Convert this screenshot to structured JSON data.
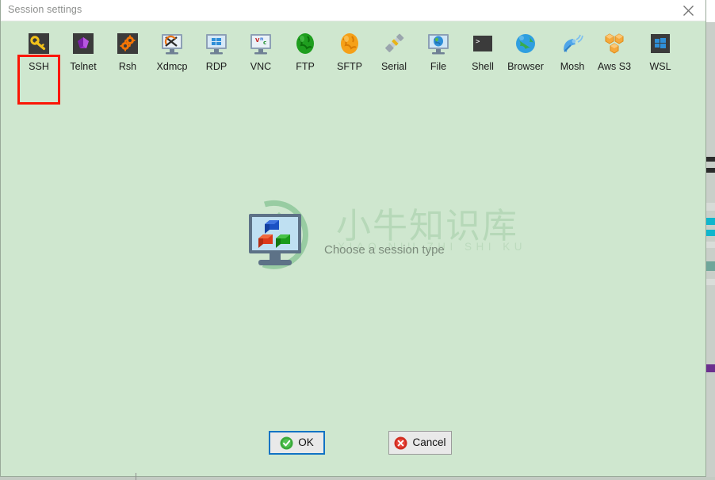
{
  "window": {
    "title": "Session settings",
    "close_icon": "close-icon",
    "background_color": "#cfe7cf",
    "titlebar_color": "#ffffff"
  },
  "session_types": {
    "selected": "SSH",
    "selection_color": "#fb1605",
    "items": [
      {
        "label": "SSH",
        "icon": "key-icon"
      },
      {
        "label": "Telnet",
        "icon": "telnet-crystal-icon"
      },
      {
        "label": "Rsh",
        "icon": "gears-icon"
      },
      {
        "label": "Xdmcp",
        "icon": "xdmcp-monitor-icon"
      },
      {
        "label": "RDP",
        "icon": "windows-monitor-icon"
      },
      {
        "label": "VNC",
        "icon": "vnc-monitor-icon"
      },
      {
        "label": "FTP",
        "icon": "green-globe-icon"
      },
      {
        "label": "SFTP",
        "icon": "orange-globe-icon"
      },
      {
        "label": "Serial",
        "icon": "serial-plug-icon"
      },
      {
        "label": "File",
        "icon": "file-monitor-icon"
      },
      {
        "label": "Shell",
        "icon": "terminal-icon"
      },
      {
        "label": "Browser",
        "icon": "blue-globe-icon"
      },
      {
        "label": "Mosh",
        "icon": "satellite-dish-icon"
      },
      {
        "label": "Aws S3",
        "icon": "aws-cubes-icon"
      },
      {
        "label": "WSL",
        "icon": "windows-logo-icon"
      }
    ]
  },
  "main": {
    "hint_text": "Choose a session type",
    "hint_color": "#7c8b7c",
    "watermark_cn": "小牛知识库",
    "watermark_pinyin": "XIAO NIU ZHI SHI KU",
    "watermark_color": "#b6d8b8",
    "monitor_icon": "monitor-cubes-icon"
  },
  "footer": {
    "ok_label": "OK",
    "ok_icon": "green-check-icon",
    "ok_focus_color": "#1173c4",
    "cancel_label": "Cancel",
    "cancel_icon": "red-x-icon"
  }
}
